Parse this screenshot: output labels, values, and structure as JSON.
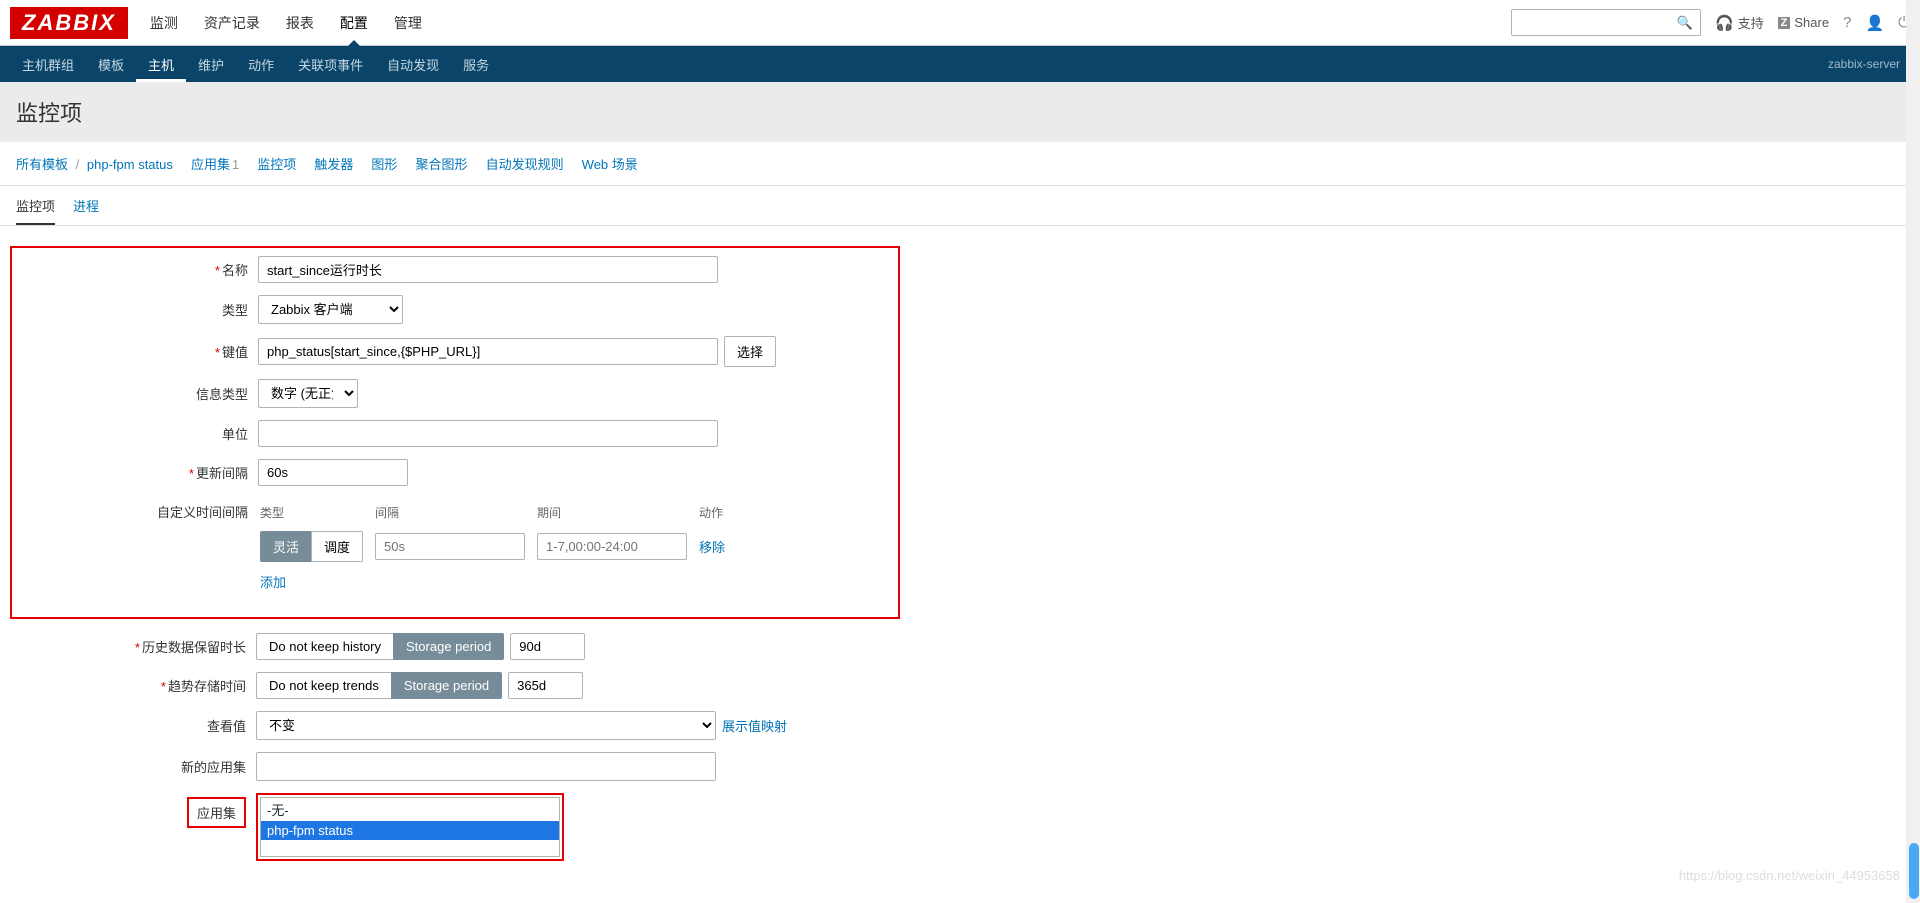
{
  "logo": "ZABBIX",
  "mainMenu": {
    "monitor": "监测",
    "inventory": "资产记录",
    "reports": "报表",
    "config": "配置",
    "admin": "管理"
  },
  "topRight": {
    "support": "支持",
    "share": "Share"
  },
  "subMenu": {
    "hostGroups": "主机群组",
    "templates": "模板",
    "hosts": "主机",
    "maintenance": "维护",
    "actions": "动作",
    "correlation": "关联项事件",
    "discovery": "自动发现",
    "services": "服务",
    "server": "zabbix-server"
  },
  "pageTitle": "监控项",
  "breadcrumb": {
    "allTemplates": "所有模板",
    "template": "php-fpm status",
    "apps": "应用集",
    "appsCount": "1",
    "items": "监控项",
    "triggers": "触发器",
    "graphs": "图形",
    "screens": "聚合图形",
    "discovery": "自动发现规则",
    "web": "Web 场景"
  },
  "tabs": {
    "item": "监控项",
    "process": "进程"
  },
  "labels": {
    "name": "名称",
    "type": "类型",
    "key": "键值",
    "infoType": "信息类型",
    "units": "单位",
    "updateInterval": "更新间隔",
    "customInterval": "自定义时间间隔",
    "ciType": "类型",
    "ciInterval": "间隔",
    "ciPeriod": "期间",
    "ciAction": "动作",
    "historyRetention": "历史数据保留时长",
    "trendRetention": "趋势存储时间",
    "showValue": "查看值",
    "newApp": "新的应用集",
    "apps": "应用集"
  },
  "values": {
    "name": "start_since运行时长",
    "type": "Zabbix 客户端",
    "key": "php_status[start_since,{$PHP_URL}]",
    "infoType": "数字 (无正负)",
    "units": "",
    "updateInterval": "60s",
    "ciFlexible": "灵活",
    "ciScheduling": "调度",
    "ciIntervalPh": "50s",
    "ciPeriodPh": "1-7,00:00-24:00",
    "ciRemove": "移除",
    "ciAdd": "添加",
    "historyNoKeep": "Do not keep history",
    "historyPeriod": "Storage period",
    "historyVal": "90d",
    "trendNoKeep": "Do not keep trends",
    "trendPeriod": "Storage period",
    "trendVal": "365d",
    "showValueSel": "不变",
    "showValueMap": "展示值映射",
    "selectBtn": "选择",
    "appNone": "-无-",
    "appPhp": "php-fpm status"
  },
  "watermark": "https://blog.csdn.net/weixin_44953658"
}
